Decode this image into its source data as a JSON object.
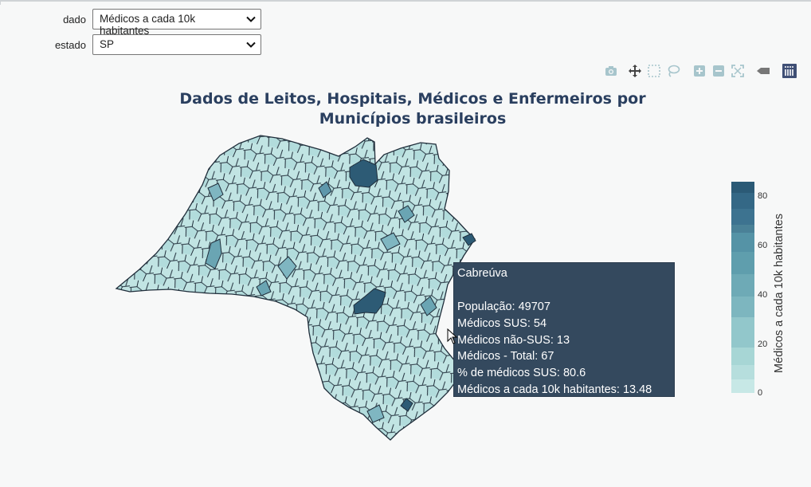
{
  "controls": {
    "dado": {
      "label": "dado",
      "value": "Médicos a cada 10k habitantes"
    },
    "estado": {
      "label": "estado",
      "value": "SP"
    }
  },
  "chart": {
    "title_line1": "Dados de Leitos, Hospitais, Médicos e Enfermeiros por",
    "title_line2": "Municípios brasileiros",
    "colorbar": {
      "title": "Médicos a cada 10k habitantes",
      "ticks": [
        "80",
        "60",
        "40",
        "20",
        "0"
      ],
      "range": [
        0,
        88
      ],
      "colors": {
        "low": "#c7e8e6",
        "mid": "#8fc7cb",
        "high": "#2b5a76"
      }
    }
  },
  "tooltip": {
    "name": "Cabreúva",
    "blank": "",
    "lines": [
      "População:  49707",
      "Médicos SUS:  54",
      "Médicos não-SUS:  13",
      "Médicos - Total:  67",
      "% de médicos SUS:  80.6",
      "Médicos a cada 10k habitantes:  13.48"
    ]
  },
  "icons": {
    "modebar": [
      "camera-icon",
      "pan-icon",
      "box-select-icon",
      "lasso-icon",
      "zoom-in-icon",
      "zoom-out-icon",
      "autoscale-icon",
      "hover-icon",
      "plotly-logo-icon"
    ],
    "select": "chevron-down-icon"
  }
}
